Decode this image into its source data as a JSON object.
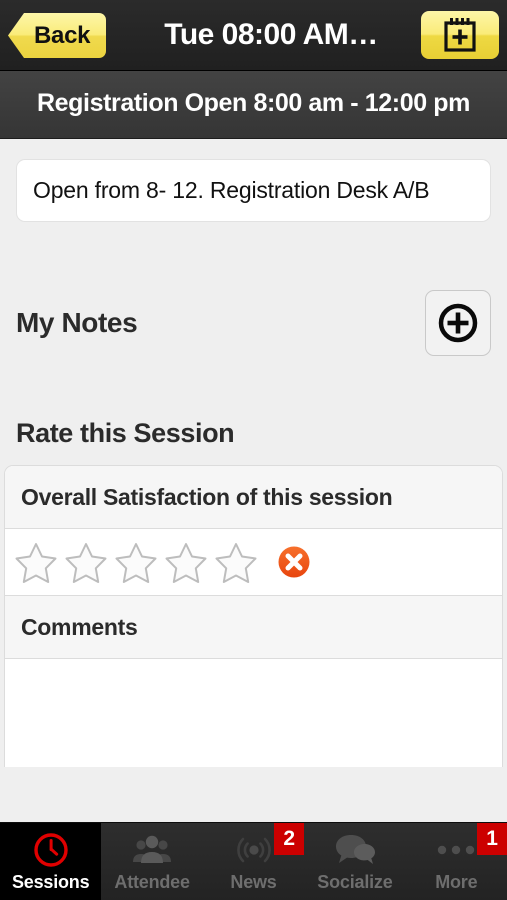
{
  "navbar": {
    "back_label": "Back",
    "title": "Tue 08:00 AM…",
    "calendar_icon": "calendar-add-icon"
  },
  "subtitle": {
    "text": "Registration Open 8:00 am - 12:00 pm"
  },
  "description": {
    "text": "Open from 8- 12. Registration Desk A/B"
  },
  "notes": {
    "title": "My Notes",
    "add_icon": "circle-plus-icon"
  },
  "rating": {
    "section_title": "Rate this Session",
    "question": "Overall Satisfaction of this session",
    "stars_total": 5,
    "stars_selected": 0,
    "clear_icon": "circle-x-icon",
    "clear_color": "#f4601e",
    "comments_label": "Comments",
    "comments_value": ""
  },
  "tabbar": {
    "active_index": 0,
    "active_color": "#e00000",
    "badge_color": "#cc0000",
    "items": [
      {
        "label": "Sessions",
        "icon": "clock-icon",
        "badge": ""
      },
      {
        "label": "Attendee",
        "icon": "people-group-icon",
        "badge": ""
      },
      {
        "label": "News",
        "icon": "broadcast-icon",
        "badge": "2"
      },
      {
        "label": "Socialize",
        "icon": "chat-bubbles-icon",
        "badge": ""
      },
      {
        "label": "More",
        "icon": "ellipsis-icon",
        "badge": "1"
      }
    ]
  }
}
